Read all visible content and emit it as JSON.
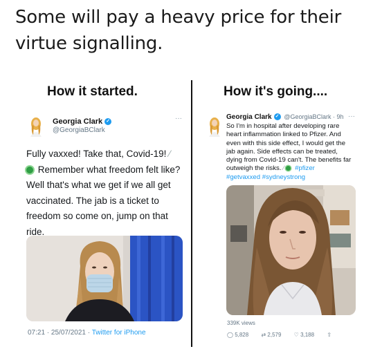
{
  "caption": {
    "line1": "Some will pay a heavy price for their",
    "line2": "virtue signalling."
  },
  "left": {
    "title": "How it started.",
    "name": "Georgia Clark",
    "handle": "@GeorgiaBClark",
    "text_line1": "Fully vaxxed! Take that, Covid-19!",
    "text_line2": "Remember what freedom felt like?",
    "text_line3": "Well that's what we get if we all get vaccinated. The jab is a ticket to freedom so come on, jump on that ride.",
    "footer_time": "07:21 · 25/07/2021 ·",
    "footer_app": "Twitter for iPhone"
  },
  "right": {
    "title": "How it's going....",
    "name": "Georgia Clark",
    "handle_time": "@GeorgiaBClark · 9h",
    "text_main": "So I'm in hospital after developing rare heart inflammation linked to Pfizer. And even with this side effect, I would get the jab again. Side effects can be treated, dying from Covid-19 can't. The benefits far outweigh the risks.",
    "tag_pfizer": "#pfizer",
    "tags_more": "#getvaxxed #sydneystrong",
    "views": "339K views",
    "comments": "5,828",
    "retweets": "2,579",
    "likes": "3,188"
  },
  "colors": {
    "link": "#1d9bf0",
    "verified": "#1d9bf0",
    "muted": "#657786"
  },
  "icons": [
    "verified-badge-icon",
    "syringe-icon",
    "virus-icon",
    "more-dots-icon",
    "comment-icon",
    "retweet-icon",
    "like-icon",
    "share-icon"
  ]
}
